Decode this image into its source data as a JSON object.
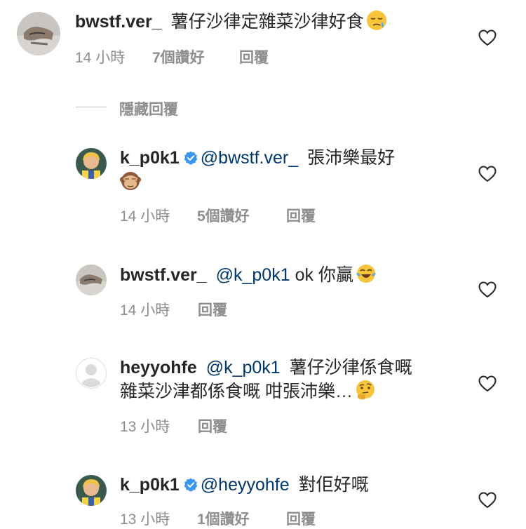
{
  "comments": [
    {
      "username": "bwstf.ver_",
      "verified": false,
      "mention": "",
      "body": "薯仔沙律定雜菜沙律好食",
      "body_line2": "",
      "emoji": "pensive-face",
      "time": "14 小時",
      "likes": "7個讚好",
      "reply": "回覆"
    },
    {
      "username": "k_p0k1",
      "verified": true,
      "mention": "@bwstf.ver_",
      "body": "張沛樂最好",
      "body_line2": "",
      "emoji": "see-no-evil-monkey",
      "time": "14 小時",
      "likes": "5個讚好",
      "reply": "回覆"
    },
    {
      "username": "bwstf.ver_",
      "verified": false,
      "mention": "@k_p0k1",
      "body": "ok 你贏",
      "body_line2": "",
      "emoji": "face-with-tears-of-joy",
      "time": "14 小時",
      "likes": "",
      "reply": "回覆"
    },
    {
      "username": "heyyohfe",
      "verified": false,
      "mention": "@k_p0k1",
      "body": "薯仔沙律係食嘅",
      "body_line2": "雜菜沙津都係食嘅 咁張沛樂…",
      "emoji": "thinking-face",
      "time": "13 小時",
      "likes": "",
      "reply": "回覆"
    },
    {
      "username": "k_p0k1",
      "verified": true,
      "mention": "@heyyohfe",
      "body": "對佢好嘅",
      "body_line2": "",
      "emoji": "",
      "time": "13 小時",
      "likes": "1個讚好",
      "reply": "回覆"
    }
  ],
  "hide_replies_label": "隱藏回覆",
  "colors": {
    "text": "#262626",
    "meta": "#8e8e8e",
    "mention": "#00376b",
    "verified": "#3897f0"
  },
  "icons": {
    "like": "heart-outline-icon",
    "verified": "verified-badge-icon"
  }
}
